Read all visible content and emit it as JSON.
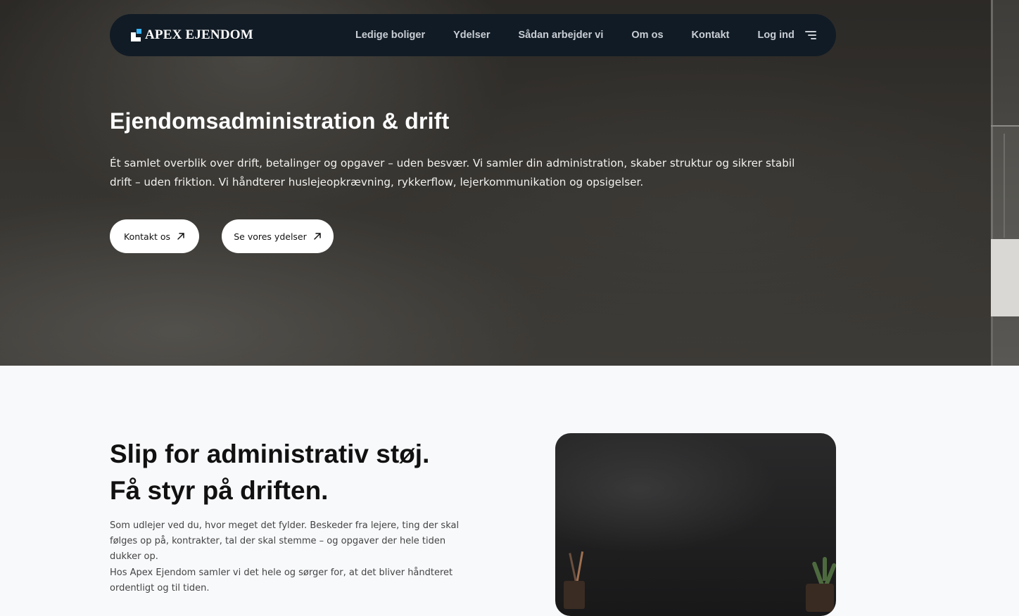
{
  "brand": {
    "name": "APEX EJENDOM",
    "accent_color": "#38b6ff"
  },
  "nav": {
    "items": [
      {
        "label": "Ledige boliger"
      },
      {
        "label": "Ydelser"
      },
      {
        "label": "Sådan arbejder vi"
      },
      {
        "label": "Om os"
      },
      {
        "label": "Kontakt"
      },
      {
        "label": "Log ind"
      }
    ],
    "menu_icon": "hamburger-menu-icon"
  },
  "hero": {
    "title": "Ejendomsadministration & drift",
    "description": "Ét samlet overblik over drift, betalinger og opgaver – uden besvær. Vi samler din administration, skaber struktur og sikrer stabil drift – uden friktion. Vi håndterer huslejeopkrævning, rykkerflow, lejerkommunikation og opsigelser.",
    "buttons": {
      "contact": "Kontakt os",
      "services": "Se vores ydelser"
    },
    "button_icon": "arrow-up-right-icon"
  },
  "intro": {
    "title_line1": "Slip for administrativ støj.",
    "title_line2": "Få styr på driften.",
    "paragraph1": "Som udlejer ved du, hvor meget det fylder. Beskeder fra lejere, ting der skal følges op på, kontrakter, tal der skal stemme – og opgaver der hele tiden dukker op.",
    "paragraph2": "Hos Apex Ejendom samler vi det hele og sørger for, at det bliver håndteret ordentligt og til tiden."
  }
}
